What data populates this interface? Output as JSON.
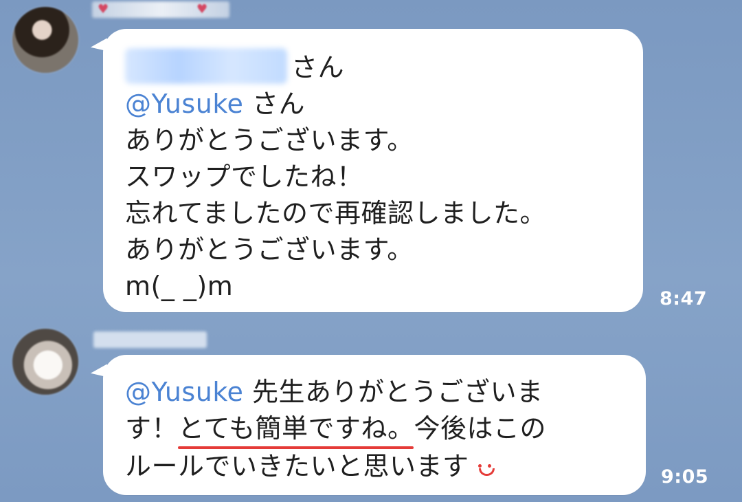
{
  "messages": [
    {
      "time": "8:47",
      "lines": {
        "line1_suffix": "さん",
        "line2_mention": "@Yusuke",
        "line2_suffix": "さん",
        "line3": "ありがとうございます。",
        "line4": "スワップでしたね！",
        "line5": "忘れてましたので再確認しました。",
        "line6": "ありがとうございます。",
        "line7": "m(_ _)m"
      }
    },
    {
      "time": "9:05",
      "lines": {
        "line1_mention": "@Yusuke",
        "line1_text": "先生ありがとうございま",
        "line2_prefix": "す！",
        "line2_underlined": "とても簡単ですね。",
        "line2_suffix": "今後はこの",
        "line3_text": "ルールでいきたいと思います"
      }
    }
  ],
  "colors": {
    "chat_background": "#7f9dc4",
    "bubble": "#ffffff",
    "mention": "#4b83d3",
    "timestamp": "#ffffff",
    "underline": "#e53b38",
    "emoji": "#e53b38"
  },
  "icons": {
    "reaction_emoticon": "smile-icon"
  }
}
